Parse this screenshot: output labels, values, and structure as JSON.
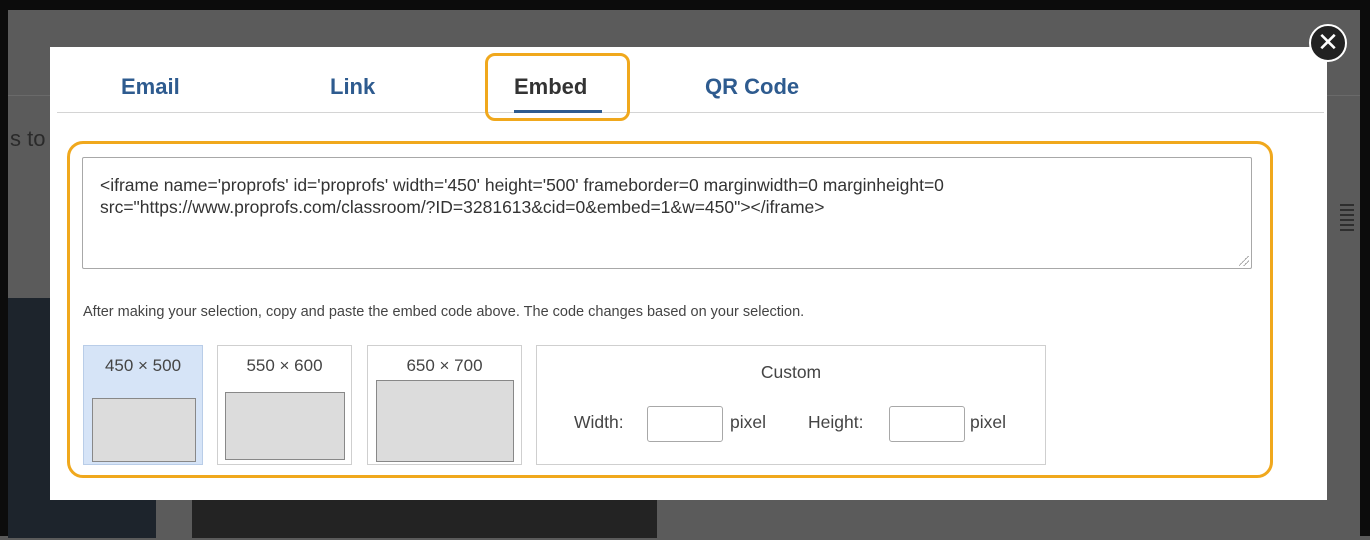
{
  "background": {
    "partial_text": "s to"
  },
  "tabs": [
    {
      "label": "Email"
    },
    {
      "label": "Link"
    },
    {
      "label": "Embed",
      "active": true
    },
    {
      "label": "QR Code"
    }
  ],
  "embed": {
    "code": "<iframe name='proprofs' id='proprofs' width='450' height='500' frameborder=0 marginwidth=0 marginheight=0 src=\"https://www.proprofs.com/classroom/?ID=3281613&cid=0&embed=1&w=450\"></iframe>",
    "hint": "After making your selection, copy and paste the embed code above. The code changes based on your selection.",
    "sizes": [
      {
        "label": "450 × 500",
        "selected": true
      },
      {
        "label": "550 × 600",
        "selected": false
      },
      {
        "label": "650 × 700",
        "selected": false
      }
    ],
    "custom": {
      "title": "Custom",
      "width_label": "Width:",
      "height_label": "Height:",
      "unit": "pixel",
      "width_value": "",
      "height_value": ""
    }
  },
  "colors": {
    "highlight": "#f0a81d",
    "tab_link": "#2e5b8f",
    "selected_option": "#d6e4f7"
  },
  "icons": {
    "close": "close-icon"
  }
}
